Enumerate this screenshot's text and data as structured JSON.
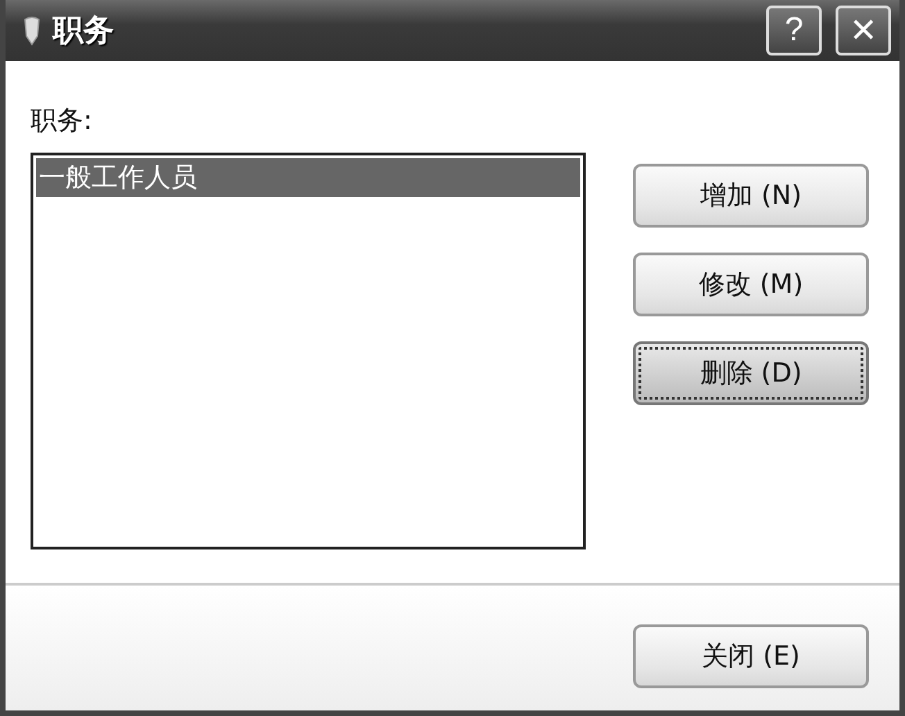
{
  "window": {
    "title": "职务",
    "title_buttons": [
      "?",
      "✕"
    ]
  },
  "list_label": "职务:",
  "list_items": [
    {
      "text": "一般工作人员",
      "selected": true
    }
  ],
  "side_buttons": [
    {
      "label": "增加 (N)",
      "focused": false
    },
    {
      "label": "修改 (M)",
      "focused": false
    },
    {
      "label": "删除 (D)",
      "focused": true
    }
  ],
  "footer_button": {
    "label": "关闭 (E)"
  }
}
